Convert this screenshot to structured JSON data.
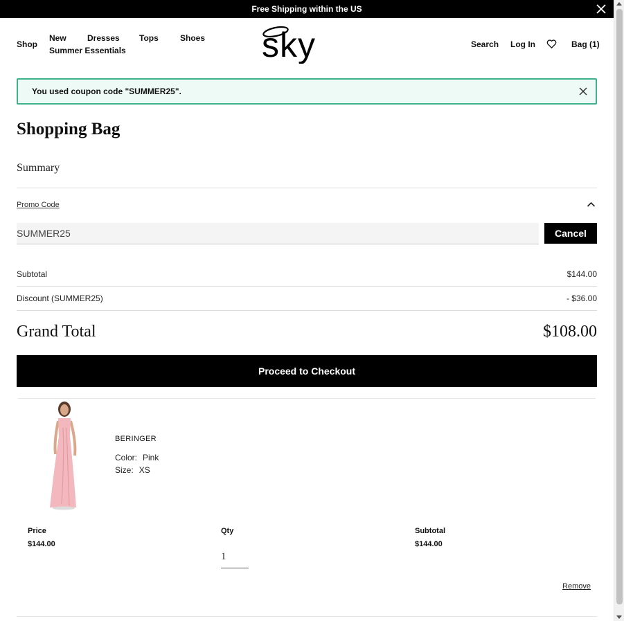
{
  "announcement": {
    "text": "Free Shipping within the US",
    "close_icon": "close-icon"
  },
  "nav": {
    "shop": "Shop",
    "new": "New",
    "dresses": "Dresses",
    "tops": "Tops",
    "shoes": "Shoes",
    "summer": "Summer Essentials",
    "logo_text": "sky",
    "search": "Search",
    "login": "Log In",
    "wishlist_icon": "heart-icon",
    "bag": "Bag (1)"
  },
  "alert": {
    "message": "You used coupon code \"SUMMER25\".",
    "close_icon": "close-icon"
  },
  "page_title": "Shopping Bag",
  "summary": {
    "title": "Summary",
    "promo_label": "Promo Code",
    "promo_value": "SUMMER25",
    "cancel_label": "Cancel",
    "subtotal_label": "Subtotal",
    "subtotal_value": "$144.00",
    "discount_label": "Discount (SUMMER25)",
    "discount_value": "- $36.00",
    "grand_label": "Grand Total",
    "grand_value": "$108.00",
    "checkout_label": "Proceed to Checkout"
  },
  "item": {
    "name": "BERINGER",
    "color_label": "Color:",
    "color_value": "Pink",
    "size_label": "Size:",
    "size_value": "XS",
    "price_label": "Price",
    "price_value": "$144.00",
    "qty_label": "Qty",
    "qty_value": "1",
    "subtotal_label": "Subtotal",
    "subtotal_value": "$144.00",
    "remove_label": "Remove"
  },
  "colors": {
    "brand_black": "#000000",
    "alert_bg": "#eefaf6",
    "alert_border": "#3fb08c",
    "dress_pink": "#f2b8bd"
  }
}
